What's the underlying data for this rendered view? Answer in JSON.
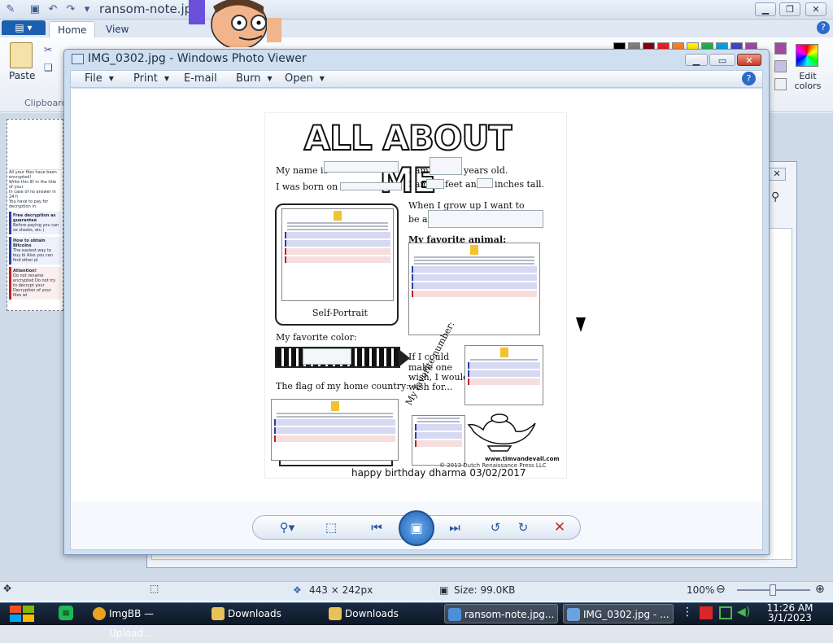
{
  "paint": {
    "title": "ransom-note.jpg",
    "quick_access": [
      "save-icon",
      "undo-icon",
      "redo-icon",
      "customize-icon"
    ],
    "file_menu_label": "▤ ▾",
    "tabs": [
      "Home",
      "View"
    ],
    "clipboard": {
      "paste": "Paste",
      "group": "Clipboard"
    },
    "edit_colors": "Edit colors",
    "palette": [
      "#000000",
      "#7f7f7f",
      "#880015",
      "#ed1c24",
      "#ff7f27",
      "#fff200",
      "#22b14c",
      "#00a2e8",
      "#3f48cc",
      "#a349a4",
      "#c8bfe7"
    ],
    "thumb_lines": [
      "All your files have been encrypted!",
      "Write this ID in the title of your",
      "In case of no answer in 24 h",
      "You have to pay for decryption in"
    ],
    "thumb_blocks": [
      {
        "title": "Free decryption as guarantee",
        "text": "Before paying you can se sheets, etc.)"
      },
      {
        "title": "How to obtain Bitcoins",
        "text": "The easiest way to buy bi Also you can find other pl"
      },
      {
        "title": "Attention!",
        "text": "Do not rename encrypted Do not try to decrypt your Decryption of your files wi"
      }
    ],
    "status": {
      "dimensions": "443 × 242px",
      "size": "Size: 99.0KB",
      "zoom": "100%"
    }
  },
  "viewer": {
    "title": "IMG_0302.jpg - Windows Photo Viewer",
    "menu": [
      "File",
      "Print",
      "E-mail",
      "Burn",
      "Open"
    ],
    "help": "?",
    "controls": [
      "zoom-icon",
      "fit-window-icon",
      "previous-icon",
      "slideshow-icon",
      "next-icon",
      "rotate-counterclockwise-icon",
      "rotate-clockwise-icon",
      "delete-icon"
    ]
  },
  "worksheet": {
    "title": "ALL ABOUT ME",
    "name_label": "My name is",
    "born_label": "I was born on",
    "age_prefix": "I am",
    "age_suffix": "years old.",
    "height_prefix": "I am",
    "feet": "feet and",
    "inches": "inches tall.",
    "grow_up": "When I grow up I want to",
    "be_a": "be a",
    "animal": "My favorite animal:",
    "self_portrait": "Self-Portrait",
    "color": "My favorite color:",
    "wish_1": "If I could",
    "wish_2": "make one",
    "wish_3": "wish, I would",
    "wish_4": "wish for...",
    "flag": "The flag of my home country:",
    "number": "My favorite number:",
    "site": "www.timvandevall.com",
    "copyright": "© 2013 Dutch Renaissance Press LLC",
    "caption": "happy birthday dharma 03/02/2017"
  },
  "taskbar": {
    "items": [
      {
        "label": "ImgBB — Upload...",
        "icon_color": "#e8a321"
      },
      {
        "label": "Downloads",
        "icon_color": "#e9c257"
      },
      {
        "label": "Downloads",
        "icon_color": "#e9c257"
      },
      {
        "label": "ransom-note.jpg...",
        "icon_color": "#4a8fd8"
      },
      {
        "label": "IMG_0302.jpg - ...",
        "icon_color": "#6aa3e0"
      }
    ],
    "time": "11:26 AM",
    "date": "3/1/2023"
  }
}
